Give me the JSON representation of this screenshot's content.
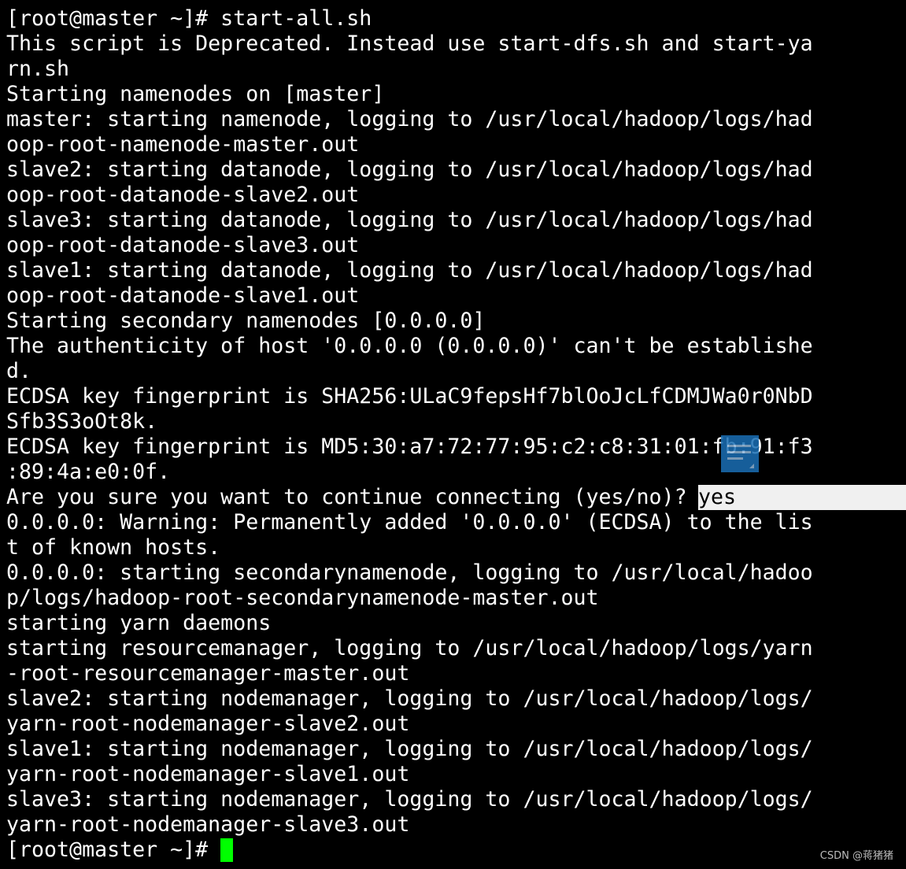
{
  "terminal": {
    "lines": [
      "[root@master ~]# start-all.sh",
      "This script is Deprecated. Instead use start-dfs.sh and start-ya",
      "rn.sh",
      "Starting namenodes on [master]",
      "master: starting namenode, logging to /usr/local/hadoop/logs/had",
      "oop-root-namenode-master.out",
      "slave2: starting datanode, logging to /usr/local/hadoop/logs/had",
      "oop-root-datanode-slave2.out",
      "slave3: starting datanode, logging to /usr/local/hadoop/logs/had",
      "oop-root-datanode-slave3.out",
      "slave1: starting datanode, logging to /usr/local/hadoop/logs/had",
      "oop-root-datanode-slave1.out",
      "Starting secondary namenodes [0.0.0.0]",
      "The authenticity of host '0.0.0.0 (0.0.0.0)' can't be establishe",
      "d.",
      "ECDSA key fingerprint is SHA256:ULaC9fepsHf7blOoJcLfCDMJWa0r0NbD",
      "Sfb3S3oOt8k.",
      "ECDSA key fingerprint is MD5:30:a7:72:77:95:c2:c8:31:01:fb:91:f3",
      ":89:4a:e0:0f."
    ],
    "confirm_prompt": "Are you sure you want to continue connecting (yes/no)? ",
    "confirm_answer": "yes",
    "lines_after": [
      "0.0.0.0: Warning: Permanently added '0.0.0.0' (ECDSA) to the lis",
      "t of known hosts.",
      "0.0.0.0: starting secondarynamenode, logging to /usr/local/hadoo",
      "p/logs/hadoop-root-secondarynamenode-master.out",
      "starting yarn daemons",
      "starting resourcemanager, logging to /usr/local/hadoop/logs/yarn",
      "-root-resourcemanager-master.out",
      "slave2: starting nodemanager, logging to /usr/local/hadoop/logs/",
      "yarn-root-nodemanager-slave2.out",
      "slave1: starting nodemanager, logging to /usr/local/hadoop/logs/",
      "yarn-root-nodemanager-slave1.out",
      "slave3: starting nodemanager, logging to /usr/local/hadoop/logs/",
      "yarn-root-nodemanager-slave3.out"
    ],
    "final_prompt": "[root@master ~]# ",
    "cursor_color": "#00ff00",
    "overlay_icon": "document-icon",
    "overlay_color": "#1a6fb5"
  },
  "watermark": "CSDN @蒋猪猪"
}
